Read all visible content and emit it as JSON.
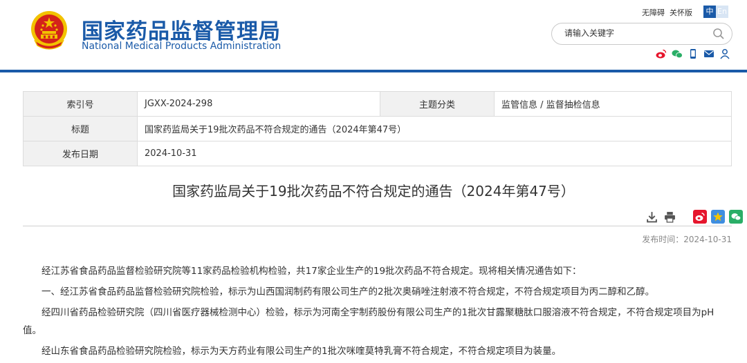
{
  "header": {
    "title_cn": "国家药品监督管理局",
    "title_en": "National Medical Products Administration",
    "accessibility": "无障碍",
    "care_mode": "关怀版",
    "lang_zh": "中",
    "lang_en": "En",
    "search_placeholder": "请输入关键字",
    "icons": [
      "weibo-icon",
      "wechat-icon",
      "mobile-icon",
      "mail-icon",
      "user-icon"
    ],
    "colors": {
      "brand": "#1a5aa8",
      "emblem_red": "#d4221a",
      "emblem_gold": "#f2c200"
    }
  },
  "info_table": {
    "index_label": "索引号",
    "index_value": "JGXX-2024-298",
    "category_label": "主题分类",
    "category_value": "监管信息 / 监督抽检信息",
    "title_label": "标题",
    "title_value": "国家药监局关于19批次药品不符合规定的通告（2024年第47号）",
    "date_label": "发布日期",
    "date_value": "2024-10-31"
  },
  "article": {
    "title": "国家药监局关于19批次药品不符合规定的通告（2024年第47号）",
    "publish_time": "发布时间：2024-10-31",
    "paragraphs": [
      "经江苏省食品药品监督检验研究院等11家药品检验机构检验，共17家企业生产的19批次药品不符合规定。现将相关情况通告如下：",
      "一、经江苏省食品药品监督检验研究院检验，标示为山西国润制药有限公司生产的2批次奥硝唑注射液不符合规定，不符合规定项目为丙二醇和乙醇。",
      "经四川省药品检验研究院（四川省医疗器械检测中心）检验，标示为河南全宇制药股份有限公司生产的1批次甘露聚糖肽口服溶液不符合规定，不符合规定项目为pH值。",
      "经山东省食品药品检验研究院检验，标示为天方药业有限公司生产的1批次咪喹莫特乳膏不符合规定，不符合规定项目为装量。"
    ]
  },
  "tools": [
    "download-icon",
    "print-icon",
    "share-weibo-icon",
    "share-qzone-icon",
    "share-wechat-icon"
  ]
}
